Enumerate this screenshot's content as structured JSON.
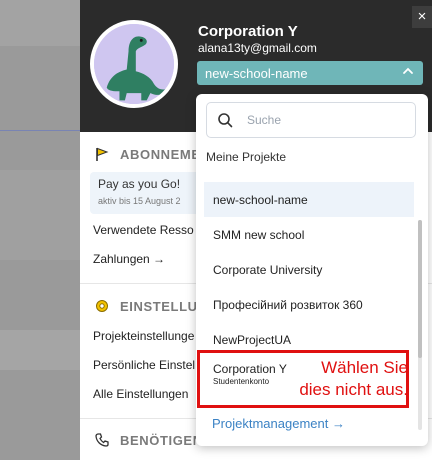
{
  "header": {
    "org_name": "Corporation Y",
    "email": "alana13ty@gmail.com",
    "selected_project": "new-school-name",
    "close_label": "×"
  },
  "sections": {
    "subscription": {
      "title": "ABONNEMEN",
      "plan": "Pay as you Go!",
      "until": "aktiv bis 15 August 2",
      "resources": "Verwendete Resso",
      "payments": "Zahlungen →"
    },
    "settings": {
      "title": "EINSTELLUNG",
      "items": [
        "Projekteinstellunge",
        "Persönliche Einstel",
        "Alle Einstellungen"
      ]
    },
    "help": {
      "title": "BENÖTIGEN"
    }
  },
  "dropdown": {
    "search_placeholder": "Suche",
    "heading": "Meine Projekte",
    "projects": [
      {
        "label": "new-school-name"
      },
      {
        "label": "SMM new school"
      },
      {
        "label": "Corporate University"
      },
      {
        "label": "Професійний розвиток 360"
      },
      {
        "label": "NewProjectUA"
      },
      {
        "label": "Corporation Y",
        "sub": "Studentenkonto"
      }
    ],
    "footer_link": "Projektmanagement →"
  },
  "annotation": {
    "line1": "Wählen Sie",
    "line2": "dies nicht aus."
  },
  "colors": {
    "header_bg": "#2b2b2b",
    "select_bg": "#6fb6b8",
    "link": "#3b82c4",
    "annotation": "#e01010"
  }
}
